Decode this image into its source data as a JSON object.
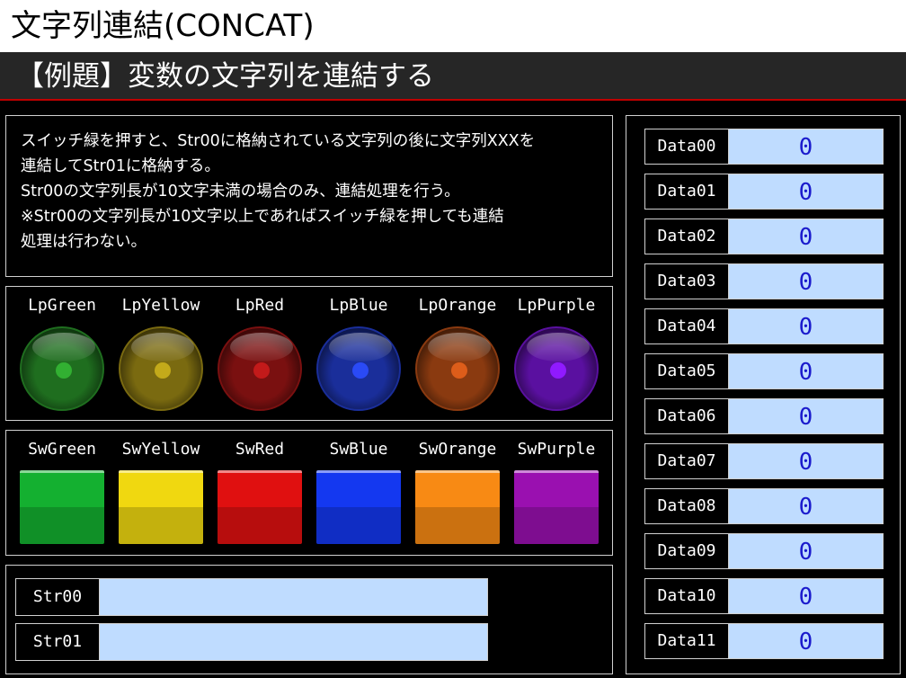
{
  "title": "文字列連結(CONCAT)",
  "subtitle": "【例題】変数の文字列を連結する",
  "description": [
    "スイッチ緑を押すと、Str00に格納されている文字列の後に文字列XXXを",
    "連結してStr01に格納する。",
    "Str00の文字列長が10文字未満の場合のみ、連結処理を行う。",
    "※Str00の文字列長が10文字以上であればスイッチ緑を押しても連結",
    "処理は行わない。"
  ],
  "lamps": [
    {
      "label": "LpGreen",
      "color": "#1f6e1f",
      "icon": "lamp-green-icon"
    },
    {
      "label": "LpYellow",
      "color": "#7a6a10",
      "icon": "lamp-yellow-icon"
    },
    {
      "label": "LpRed",
      "color": "#7a1010",
      "icon": "lamp-red-icon"
    },
    {
      "label": "LpBlue",
      "color": "#1a2e9a",
      "icon": "lamp-blue-icon"
    },
    {
      "label": "LpOrange",
      "color": "#8a3a10",
      "icon": "lamp-orange-icon"
    },
    {
      "label": "LpPurple",
      "color": "#5a10a0",
      "icon": "lamp-purple-icon"
    }
  ],
  "switches": [
    {
      "label": "SwGreen",
      "color": "#14b030"
    },
    {
      "label": "SwYellow",
      "color": "#f0d810"
    },
    {
      "label": "SwRed",
      "color": "#e01010"
    },
    {
      "label": "SwBlue",
      "color": "#1438f0"
    },
    {
      "label": "SwOrange",
      "color": "#f88a14"
    },
    {
      "label": "SwPurple",
      "color": "#9a10b0"
    }
  ],
  "strings": [
    {
      "label": "Str00",
      "value": ""
    },
    {
      "label": "Str01",
      "value": ""
    }
  ],
  "data": [
    {
      "label": "Data00",
      "value": "0"
    },
    {
      "label": "Data01",
      "value": "0"
    },
    {
      "label": "Data02",
      "value": "0"
    },
    {
      "label": "Data03",
      "value": "0"
    },
    {
      "label": "Data04",
      "value": "0"
    },
    {
      "label": "Data05",
      "value": "0"
    },
    {
      "label": "Data06",
      "value": "0"
    },
    {
      "label": "Data07",
      "value": "0"
    },
    {
      "label": "Data08",
      "value": "0"
    },
    {
      "label": "Data09",
      "value": "0"
    },
    {
      "label": "Data10",
      "value": "0"
    },
    {
      "label": "Data11",
      "value": "0"
    }
  ]
}
